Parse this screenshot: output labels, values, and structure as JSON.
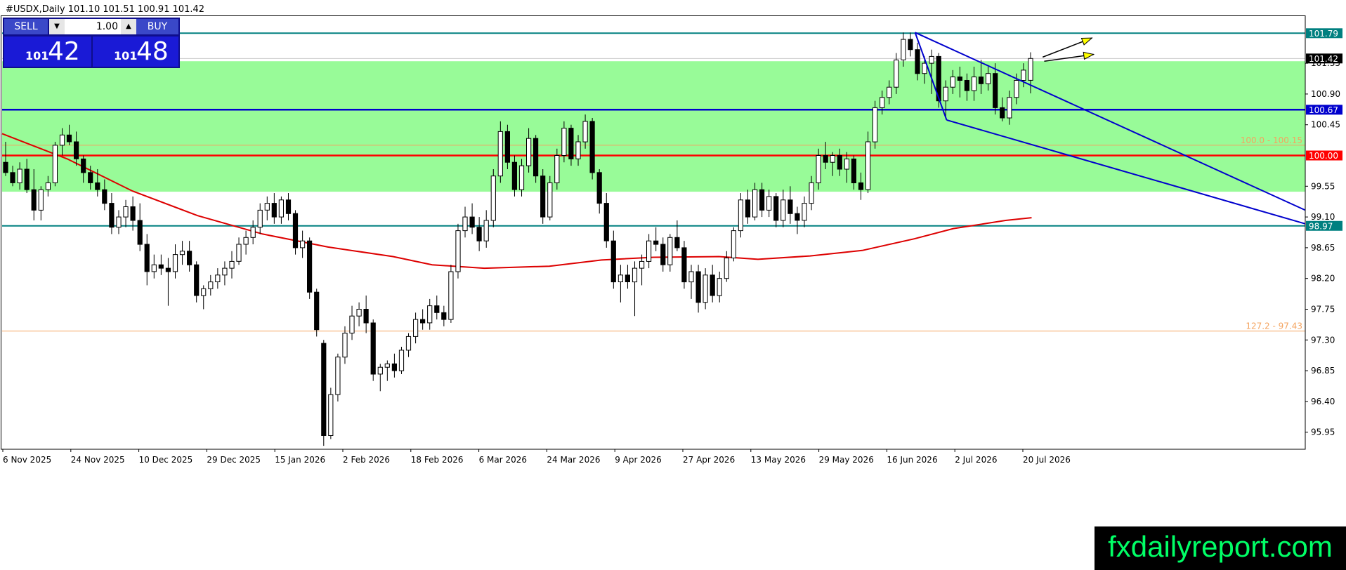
{
  "chart_title": "#USDX,Daily  101.10 101.51 100.91 101.42",
  "trade_panel": {
    "sell_label": "SELL",
    "buy_label": "BUY",
    "lot": "1.00",
    "sell_price_small": "101",
    "sell_price_big": "42",
    "buy_price_small": "101",
    "buy_price_big": "48",
    "down_arrow": "▼",
    "up_arrow": "▲"
  },
  "brand_text": "fxdailyreport.com",
  "colors": {
    "zone": "#98fb98",
    "resistance_line": "#008080",
    "channel_line": "#0000cd",
    "key_level": "#ff0000",
    "fib_line": "#f4a460",
    "moving_average": "#dd0000",
    "bull_candle": "#ffffff",
    "bear_candle": "#000000"
  },
  "chart_data": {
    "type": "candlestick",
    "title": "#USDX,Daily",
    "ohlc_header": {
      "open": 101.1,
      "high": 101.51,
      "low": 100.91,
      "close": 101.42
    },
    "ylim": [
      95.7,
      102.05
    ],
    "y_ticks": [
      "101.35",
      "100.90",
      "100.45",
      "99.55",
      "99.10",
      "98.65",
      "98.20",
      "97.75",
      "97.30",
      "96.85",
      "96.40",
      "95.95"
    ],
    "x_ticks": [
      "6 Nov 2025",
      "24 Nov 2025",
      "10 Dec 2025",
      "29 Dec 2025",
      "15 Jan 2026",
      "2 Feb 2026",
      "18 Feb 2026",
      "6 Mar 2026",
      "24 Mar 2026",
      "9 Apr 2026",
      "27 Apr 2026",
      "13 May 2026",
      "29 May 2026",
      "16 Jun 2026",
      "2 Jul 2026",
      "20 Jul 2026"
    ],
    "levels": [
      {
        "value": 101.79,
        "label": "101.79",
        "color": "#008080",
        "style": "tag"
      },
      {
        "value": 101.42,
        "label": "101.42",
        "color": "#000000",
        "style": "current"
      },
      {
        "value": 100.67,
        "label": "100.67",
        "color": "#0000cd",
        "style": "tag"
      },
      {
        "value": 100.0,
        "label": "100.00",
        "color": "#ff0000",
        "style": "tag"
      },
      {
        "value": 98.97,
        "label": "98.97",
        "color": "#008080",
        "style": "tag"
      },
      {
        "value": 100.15,
        "label": "100.0 - 100.15",
        "color": "#f4a460",
        "style": "text"
      },
      {
        "value": 97.43,
        "label": "127.2 - 97.43",
        "color": "#f4a460",
        "style": "text"
      }
    ],
    "zone": {
      "from": 99.47,
      "to": 101.38
    },
    "channel": {
      "upper": [
        {
          "x": 0.7006,
          "y": 101.8
        },
        {
          "x": 1.0,
          "y": 99.2
        }
      ],
      "lower": [
        {
          "x": 0.7248,
          "y": 100.52
        },
        {
          "x": 1.0,
          "y": 99.0
        }
      ],
      "connector": [
        {
          "x": 0.7006,
          "y": 101.8
        },
        {
          "x": 0.7248,
          "y": 100.52
        }
      ]
    },
    "arrows": [
      {
        "from": {
          "x": 0.7985,
          "y": 101.44
        },
        "to": {
          "x": 0.8363,
          "y": 101.72
        }
      },
      {
        "from": {
          "x": 0.7997,
          "y": 101.38
        },
        "to": {
          "x": 0.8376,
          "y": 101.48
        }
      }
    ],
    "moving_average": [
      {
        "x": 0.0,
        "y": 100.32
      },
      {
        "x": 0.05,
        "y": 99.95
      },
      {
        "x": 0.1,
        "y": 99.48
      },
      {
        "x": 0.15,
        "y": 99.12
      },
      {
        "x": 0.2,
        "y": 98.85
      },
      {
        "x": 0.25,
        "y": 98.66
      },
      {
        "x": 0.3,
        "y": 98.52
      },
      {
        "x": 0.33,
        "y": 98.4
      },
      {
        "x": 0.37,
        "y": 98.35
      },
      {
        "x": 0.42,
        "y": 98.38
      },
      {
        "x": 0.46,
        "y": 98.47
      },
      {
        "x": 0.5,
        "y": 98.51
      },
      {
        "x": 0.55,
        "y": 98.52
      },
      {
        "x": 0.58,
        "y": 98.48
      },
      {
        "x": 0.62,
        "y": 98.53
      },
      {
        "x": 0.66,
        "y": 98.61
      },
      {
        "x": 0.7,
        "y": 98.78
      },
      {
        "x": 0.73,
        "y": 98.93
      },
      {
        "x": 0.77,
        "y": 99.05
      },
      {
        "x": 0.79,
        "y": 99.09
      }
    ],
    "candles": [
      [
        99.9,
        100.2,
        99.7,
        99.75
      ],
      [
        99.75,
        99.85,
        99.55,
        99.6
      ],
      [
        99.6,
        99.9,
        99.5,
        99.8
      ],
      [
        99.8,
        99.95,
        99.45,
        99.5
      ],
      [
        99.5,
        99.8,
        99.05,
        99.2
      ],
      [
        99.2,
        99.55,
        99.05,
        99.5
      ],
      [
        99.5,
        99.7,
        99.4,
        99.6
      ],
      [
        99.6,
        100.2,
        99.55,
        100.15
      ],
      [
        100.15,
        100.4,
        100.0,
        100.3
      ],
      [
        100.3,
        100.45,
        100.15,
        100.2
      ],
      [
        100.2,
        100.35,
        99.85,
        99.95
      ],
      [
        99.95,
        100.0,
        99.6,
        99.75
      ],
      [
        99.75,
        99.85,
        99.5,
        99.6
      ],
      [
        99.6,
        99.8,
        99.4,
        99.5
      ],
      [
        99.5,
        99.65,
        99.2,
        99.3
      ],
      [
        99.3,
        99.45,
        98.85,
        98.95
      ],
      [
        98.95,
        99.2,
        98.85,
        99.1
      ],
      [
        99.1,
        99.35,
        98.95,
        99.25
      ],
      [
        99.25,
        99.4,
        98.9,
        99.05
      ],
      [
        99.05,
        99.3,
        98.6,
        98.7
      ],
      [
        98.7,
        98.85,
        98.1,
        98.3
      ],
      [
        98.3,
        98.55,
        98.2,
        98.4
      ],
      [
        98.4,
        98.55,
        98.25,
        98.35
      ],
      [
        98.35,
        98.5,
        97.8,
        98.3
      ],
      [
        98.3,
        98.7,
        98.2,
        98.55
      ],
      [
        98.55,
        98.75,
        98.4,
        98.6
      ],
      [
        98.6,
        98.75,
        98.3,
        98.4
      ],
      [
        98.4,
        98.45,
        97.85,
        97.95
      ],
      [
        97.95,
        98.1,
        97.75,
        98.05
      ],
      [
        98.05,
        98.25,
        97.95,
        98.15
      ],
      [
        98.15,
        98.35,
        98.05,
        98.25
      ],
      [
        98.25,
        98.45,
        98.1,
        98.35
      ],
      [
        98.35,
        98.6,
        98.2,
        98.45
      ],
      [
        98.45,
        98.8,
        98.4,
        98.7
      ],
      [
        98.7,
        98.9,
        98.55,
        98.8
      ],
      [
        98.8,
        99.05,
        98.7,
        98.95
      ],
      [
        98.95,
        99.3,
        98.85,
        99.2
      ],
      [
        99.2,
        99.4,
        99.05,
        99.3
      ],
      [
        99.3,
        99.45,
        99.0,
        99.1
      ],
      [
        99.1,
        99.4,
        99.0,
        99.35
      ],
      [
        99.35,
        99.45,
        99.05,
        99.15
      ],
      [
        99.15,
        99.2,
        98.55,
        98.65
      ],
      [
        98.65,
        98.9,
        98.5,
        98.75
      ],
      [
        98.75,
        98.8,
        97.9,
        98.0
      ],
      [
        98.0,
        98.05,
        97.35,
        97.45
      ],
      [
        97.25,
        97.3,
        95.75,
        95.9
      ],
      [
        95.9,
        96.6,
        95.85,
        96.5
      ],
      [
        96.5,
        97.1,
        96.4,
        97.05
      ],
      [
        97.05,
        97.5,
        96.95,
        97.4
      ],
      [
        97.4,
        97.8,
        97.3,
        97.65
      ],
      [
        97.65,
        97.85,
        97.5,
        97.75
      ],
      [
        97.75,
        97.95,
        97.4,
        97.55
      ],
      [
        97.55,
        97.6,
        96.7,
        96.8
      ],
      [
        96.8,
        96.95,
        96.55,
        96.9
      ],
      [
        96.9,
        97.0,
        96.7,
        96.95
      ],
      [
        96.95,
        97.1,
        96.75,
        96.85
      ],
      [
        96.85,
        97.2,
        96.8,
        97.15
      ],
      [
        97.15,
        97.4,
        97.05,
        97.35
      ],
      [
        97.35,
        97.7,
        97.25,
        97.6
      ],
      [
        97.6,
        97.75,
        97.45,
        97.55
      ],
      [
        97.55,
        97.9,
        97.45,
        97.8
      ],
      [
        97.8,
        97.95,
        97.6,
        97.7
      ],
      [
        97.7,
        97.8,
        97.5,
        97.6
      ],
      [
        97.6,
        98.4,
        97.55,
        98.3
      ],
      [
        98.3,
        99.0,
        98.2,
        98.9
      ],
      [
        98.9,
        99.25,
        98.8,
        99.1
      ],
      [
        99.1,
        99.3,
        98.85,
        98.95
      ],
      [
        98.95,
        99.1,
        98.6,
        98.75
      ],
      [
        98.75,
        99.2,
        98.65,
        99.05
      ],
      [
        99.05,
        99.8,
        98.95,
        99.7
      ],
      [
        99.7,
        100.5,
        99.6,
        100.35
      ],
      [
        100.35,
        100.45,
        99.8,
        99.9
      ],
      [
        99.9,
        100.0,
        99.4,
        99.5
      ],
      [
        99.5,
        99.95,
        99.4,
        99.85
      ],
      [
        99.85,
        100.4,
        99.75,
        100.25
      ],
      [
        100.25,
        100.3,
        99.6,
        99.7
      ],
      [
        99.7,
        99.8,
        99.0,
        99.1
      ],
      [
        99.1,
        99.7,
        99.05,
        99.6
      ],
      [
        99.6,
        100.1,
        99.5,
        100.0
      ],
      [
        100.0,
        100.5,
        99.9,
        100.4
      ],
      [
        100.4,
        100.45,
        99.85,
        99.95
      ],
      [
        99.95,
        100.3,
        99.85,
        100.2
      ],
      [
        100.2,
        100.6,
        100.1,
        100.5
      ],
      [
        100.5,
        100.55,
        99.65,
        99.75
      ],
      [
        99.75,
        99.8,
        99.15,
        99.3
      ],
      [
        99.3,
        99.45,
        98.65,
        98.75
      ],
      [
        98.75,
        98.9,
        98.05,
        98.15
      ],
      [
        98.15,
        98.4,
        97.85,
        98.25
      ],
      [
        98.25,
        98.4,
        98.05,
        98.15
      ],
      [
        98.15,
        98.45,
        97.65,
        98.35
      ],
      [
        98.35,
        98.55,
        98.1,
        98.45
      ],
      [
        98.45,
        98.85,
        98.35,
        98.75
      ],
      [
        98.75,
        98.95,
        98.6,
        98.7
      ],
      [
        98.7,
        98.8,
        98.3,
        98.4
      ],
      [
        98.4,
        98.85,
        98.3,
        98.8
      ],
      [
        98.8,
        99.05,
        98.6,
        98.65
      ],
      [
        98.65,
        98.75,
        98.05,
        98.15
      ],
      [
        98.15,
        98.4,
        97.9,
        98.3
      ],
      [
        98.3,
        98.4,
        97.7,
        97.85
      ],
      [
        97.85,
        98.35,
        97.75,
        98.25
      ],
      [
        98.25,
        98.4,
        97.85,
        97.95
      ],
      [
        97.95,
        98.3,
        97.85,
        98.2
      ],
      [
        98.2,
        98.6,
        98.15,
        98.5
      ],
      [
        98.5,
        98.95,
        98.45,
        98.9
      ],
      [
        98.9,
        99.45,
        98.8,
        99.35
      ],
      [
        99.35,
        99.5,
        99.0,
        99.1
      ],
      [
        99.1,
        99.6,
        99.05,
        99.5
      ],
      [
        99.5,
        99.6,
        99.1,
        99.2
      ],
      [
        99.2,
        99.5,
        99.1,
        99.4
      ],
      [
        99.4,
        99.45,
        98.95,
        99.05
      ],
      [
        99.05,
        99.5,
        98.95,
        99.35
      ],
      [
        99.35,
        99.55,
        99.0,
        99.15
      ],
      [
        99.15,
        99.25,
        98.85,
        99.05
      ],
      [
        99.05,
        99.4,
        98.95,
        99.3
      ],
      [
        99.3,
        99.7,
        99.2,
        99.6
      ],
      [
        99.6,
        100.1,
        99.5,
        100.0
      ],
      [
        100.0,
        100.2,
        99.8,
        99.9
      ],
      [
        99.9,
        100.05,
        99.7,
        100.0
      ],
      [
        100.0,
        100.1,
        99.7,
        99.8
      ],
      [
        99.8,
        100.05,
        99.6,
        99.95
      ],
      [
        99.95,
        100.0,
        99.5,
        99.6
      ],
      [
        99.6,
        99.75,
        99.35,
        99.5
      ],
      [
        99.5,
        100.35,
        99.45,
        100.2
      ],
      [
        100.2,
        100.8,
        100.1,
        100.7
      ],
      [
        100.7,
        100.95,
        100.6,
        100.85
      ],
      [
        100.85,
        101.1,
        100.75,
        101.0
      ],
      [
        101.0,
        101.5,
        100.9,
        101.4
      ],
      [
        101.4,
        101.8,
        101.3,
        101.7
      ],
      [
        101.7,
        101.8,
        101.45,
        101.55
      ],
      [
        101.55,
        101.65,
        101.1,
        101.2
      ],
      [
        101.2,
        101.45,
        101.05,
        101.35
      ],
      [
        101.35,
        101.55,
        100.9,
        101.45
      ],
      [
        101.45,
        101.5,
        100.7,
        100.8
      ],
      [
        100.8,
        101.1,
        100.55,
        101.0
      ],
      [
        101.0,
        101.25,
        100.9,
        101.15
      ],
      [
        101.15,
        101.3,
        100.85,
        101.1
      ],
      [
        101.1,
        101.2,
        100.8,
        100.95
      ],
      [
        100.95,
        101.3,
        100.8,
        101.15
      ],
      [
        101.15,
        101.4,
        100.9,
        101.05
      ],
      [
        101.05,
        101.3,
        100.95,
        101.2
      ],
      [
        101.2,
        101.35,
        100.6,
        100.7
      ],
      [
        100.7,
        100.85,
        100.5,
        100.55
      ],
      [
        100.55,
        100.95,
        100.45,
        100.85
      ],
      [
        100.85,
        101.2,
        100.75,
        101.1
      ],
      [
        101.1,
        101.35,
        101.0,
        101.25
      ],
      [
        101.1,
        101.51,
        100.91,
        101.42
      ]
    ]
  }
}
